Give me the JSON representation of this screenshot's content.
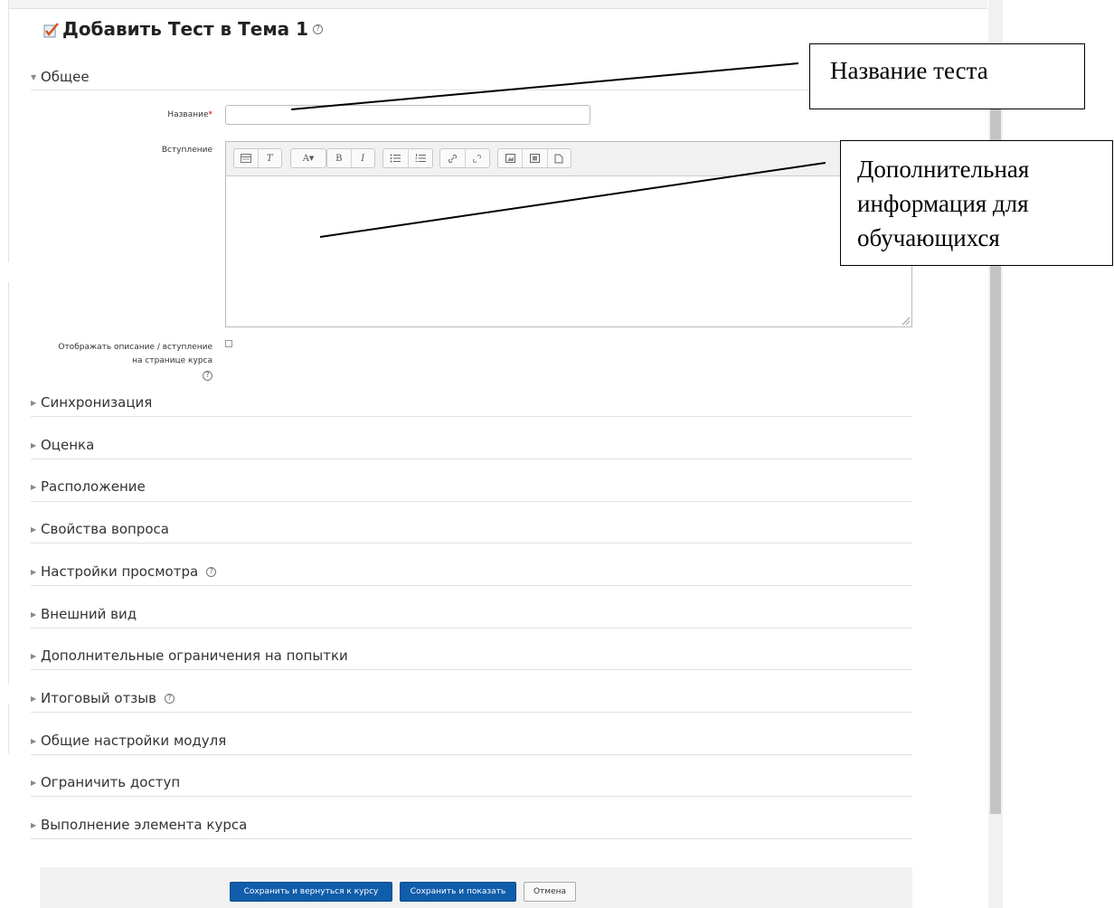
{
  "page": {
    "title": "Добавить Тест в Тема 1",
    "title_help": "?"
  },
  "general": {
    "section_label": "Общее",
    "name_label": "Название",
    "required_mark": "*",
    "name_value": "",
    "intro_label": "Вступление",
    "intro_value": "",
    "show_desc_line1": "Отображать описание / вступление",
    "show_desc_line2": "на странице курса",
    "show_desc_checked": false,
    "help": "?"
  },
  "editor_toolbar": {
    "groups": [
      [
        "toolbar-toggle-icon",
        "clear-formatting-icon"
      ],
      [
        "font-style-icon"
      ],
      [
        "bold-icon",
        "italic-icon"
      ],
      [
        "unordered-list-icon",
        "ordered-list-icon"
      ],
      [
        "link-icon",
        "unlink-icon"
      ],
      [
        "image-icon",
        "media-icon",
        "file-icon"
      ]
    ],
    "bold_glyph": "B",
    "italic_glyph": "I",
    "clear_glyph": "T",
    "font_glyph": "A"
  },
  "sections": [
    {
      "label": "Синхронизация",
      "help": false
    },
    {
      "label": "Оценка",
      "help": false
    },
    {
      "label": "Расположение",
      "help": false
    },
    {
      "label": "Свойства вопроса",
      "help": false
    },
    {
      "label": "Настройки просмотра",
      "help": true
    },
    {
      "label": "Внешний вид",
      "help": false
    },
    {
      "label": "Дополнительные ограничения на попытки",
      "help": false
    },
    {
      "label": "Итоговый отзыв",
      "help": true
    },
    {
      "label": "Общие настройки модуля",
      "help": false
    },
    {
      "label": "Ограничить доступ",
      "help": false
    },
    {
      "label": "Выполнение элемента курса",
      "help": false
    }
  ],
  "buttons": {
    "save_return": "Сохранить и вернуться к курсу",
    "save_show": "Сохранить и показать",
    "cancel": "Отмена"
  },
  "callouts": {
    "name": "Название теста",
    "info_line1": "Дополнительная",
    "info_line2": "информация для",
    "info_line3": "обучающихся"
  },
  "colors": {
    "primary_button": "#0f5dab",
    "required": "#cc0000",
    "divider": "#e2e2e2"
  }
}
